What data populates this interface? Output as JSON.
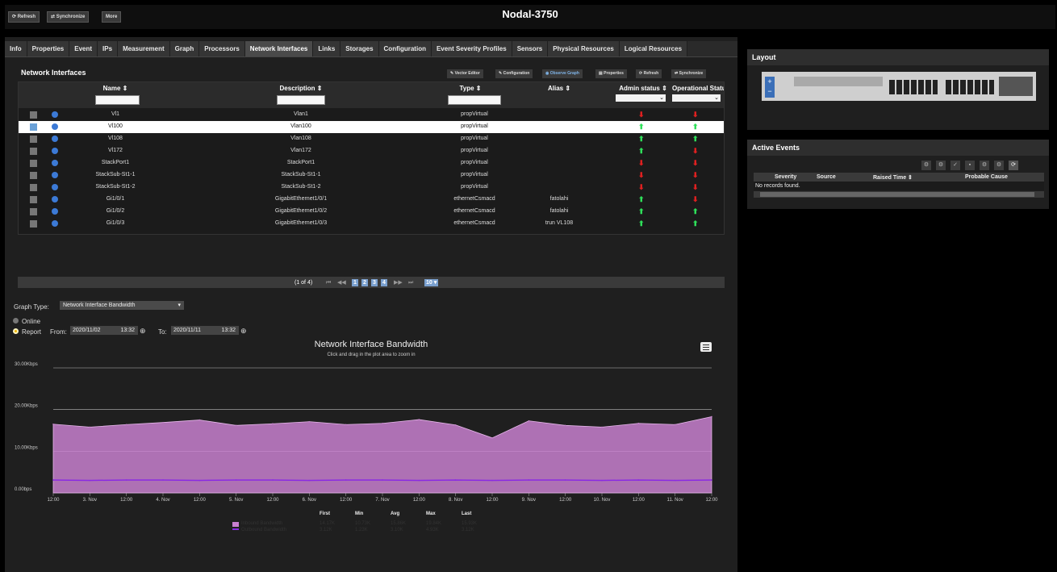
{
  "header": {
    "title": "Nodal-3750",
    "buttons": [
      {
        "label": "⟳ Refresh"
      },
      {
        "label": "⇄ Synchronize"
      },
      {
        "label": "More"
      }
    ]
  },
  "tabs": [
    "Info",
    "Properties",
    "Event",
    "IPs",
    "Measurement",
    "Graph",
    "Processors",
    "Network Interfaces",
    "Links",
    "Storages",
    "Configuration",
    "Event Severity Profiles",
    "Sensors",
    "Physical Resources",
    "Logical Resources"
  ],
  "active_tab": "Network Interfaces",
  "section": {
    "title": "Network Interfaces",
    "tools": [
      "✎ Vector Editor",
      "✎ Configuration",
      "◉ Observe Graph",
      "▤ Properties",
      "⟳ Refresh",
      "⇄ Synchronize"
    ]
  },
  "table": {
    "columns": {
      "name": "Name ⇕",
      "description": "Description ⇕",
      "type": "Type ⇕",
      "alias": "Alias ⇕",
      "admin": "Admin status ⇕",
      "oper": "Operational Status"
    },
    "rows": [
      {
        "name": "Vl1",
        "description": "Vlan1",
        "type": "propVirtual",
        "alias": "",
        "admin": "down",
        "oper": "down",
        "selected": false
      },
      {
        "name": "Vl100",
        "description": "Vlan100",
        "type": "propVirtual",
        "alias": "",
        "admin": "up",
        "oper": "up",
        "selected": true
      },
      {
        "name": "Vl108",
        "description": "Vlan108",
        "type": "propVirtual",
        "alias": "",
        "admin": "up",
        "oper": "up",
        "selected": false
      },
      {
        "name": "Vl172",
        "description": "Vlan172",
        "type": "propVirtual",
        "alias": "",
        "admin": "up",
        "oper": "down",
        "selected": false
      },
      {
        "name": "StackPort1",
        "description": "StackPort1",
        "type": "propVirtual",
        "alias": "",
        "admin": "down",
        "oper": "down",
        "selected": false
      },
      {
        "name": "StackSub-St1-1",
        "description": "StackSub-St1-1",
        "type": "propVirtual",
        "alias": "",
        "admin": "down",
        "oper": "down",
        "selected": false
      },
      {
        "name": "StackSub-St1-2",
        "description": "StackSub-St1-2",
        "type": "propVirtual",
        "alias": "",
        "admin": "down",
        "oper": "down",
        "selected": false
      },
      {
        "name": "Gi1/0/1",
        "description": "GigabitEthernet1/0/1",
        "type": "ethernetCsmacd",
        "alias": "fatolahi",
        "admin": "up",
        "oper": "down",
        "selected": false
      },
      {
        "name": "Gi1/0/2",
        "description": "GigabitEthernet1/0/2",
        "type": "ethernetCsmacd",
        "alias": "fatolahi",
        "admin": "up",
        "oper": "up",
        "selected": false
      },
      {
        "name": "Gi1/0/3",
        "description": "GigabitEthernet1/0/3",
        "type": "ethernetCsmacd",
        "alias": "trun VL108",
        "admin": "up",
        "oper": "up",
        "selected": false
      }
    ]
  },
  "pager": {
    "status": "(1 of 4)",
    "first": "⏮",
    "prev": "◀◀",
    "pages": [
      "1",
      "2",
      "3",
      "4"
    ],
    "next": "▶▶",
    "last": "⏭",
    "rows_per_page": "10 ▾"
  },
  "graph_controls": {
    "graph_type_label": "Graph Type:",
    "graph_type_value": "Network Interface Bandwidth",
    "online_label": "Online",
    "report_label": "Report",
    "from_label": "From:",
    "from_date": "2020/11/02",
    "from_time": "13:32",
    "to_label": "To:",
    "to_date": "2020/11/11",
    "to_time": "13:32"
  },
  "chart_data": {
    "type": "area",
    "title": "Network Interface Bandwidth",
    "subtitle": "Click and drag in the plot area to zoom in",
    "y_ticks": [
      "0.00bps",
      "10.00Kbps",
      "20.00Kbps",
      "30.00Kbps"
    ],
    "ylim": [
      0,
      30
    ],
    "y_unit": "Kbps",
    "x_ticks": [
      "12:00",
      "3. Nov",
      "12:00",
      "4. Nov",
      "12:00",
      "5. Nov",
      "12:00",
      "6. Nov",
      "12:00",
      "7. Nov",
      "12:00",
      "8. Nov",
      "12:00",
      "9. Nov",
      "12:00",
      "10. Nov",
      "12:00",
      "11. Nov",
      "12:00"
    ],
    "series": [
      {
        "name": "Inbound Bandwidth",
        "color": "#c880cf",
        "x": [
          "11/02 12:00",
          "11/03 00:00",
          "11/03 12:00",
          "11/04 00:00",
          "11/04 12:00",
          "11/05 00:00",
          "11/05 12:00",
          "11/06 00:00",
          "11/06 12:00",
          "11/07 00:00",
          "11/07 12:00",
          "11/08 00:00",
          "11/08 12:00",
          "11/09 00:00",
          "11/09 12:00",
          "11/10 00:00",
          "11/10 12:00",
          "11/11 00:00",
          "11/11 12:00"
        ],
        "values": [
          16.5,
          15.8,
          16.4,
          16.9,
          17.5,
          16.2,
          16.6,
          17.1,
          16.4,
          16.7,
          17.6,
          16.3,
          13.2,
          17.3,
          16.2,
          15.8,
          16.7,
          16.4,
          18.3
        ]
      },
      {
        "name": "Outbound Bandwidth",
        "color": "#8a2be2",
        "x": [
          "11/02 12:00",
          "11/03 00:00",
          "11/03 12:00",
          "11/04 00:00",
          "11/04 12:00",
          "11/05 00:00",
          "11/05 12:00",
          "11/06 00:00",
          "11/06 12:00",
          "11/07 00:00",
          "11/07 12:00",
          "11/08 00:00",
          "11/08 12:00",
          "11/09 00:00",
          "11/09 12:00",
          "11/10 00:00",
          "11/10 12:00",
          "11/11 00:00",
          "11/11 12:00"
        ],
        "values": [
          3.1,
          3.0,
          3.1,
          3.1,
          3.0,
          3.1,
          3.1,
          3.0,
          3.1,
          3.1,
          3.0,
          3.1,
          3.0,
          3.1,
          3.1,
          3.0,
          3.1,
          3.0,
          3.1
        ]
      }
    ],
    "legend_headers": [
      "First",
      "Min",
      "Avg",
      "Max",
      "Last"
    ],
    "legend_rows": [
      {
        "name": "Inbound Bandwidth",
        "vals": [
          "14.17K",
          "10.73K",
          "15.86K",
          "19.84K",
          "15.93K"
        ]
      },
      {
        "name": "Outbound Bandwidth",
        "vals": [
          "3.12K",
          "1.23K",
          "3.10K",
          "4.93K",
          "3.12K"
        ]
      }
    ]
  },
  "layout_panel": {
    "title": "Layout",
    "zoom_in": "+",
    "zoom_out": "−"
  },
  "events_panel": {
    "title": "Active Events",
    "columns": [
      "Severity",
      "Source",
      "Raised Time ⇕",
      "Probable Cause"
    ],
    "empty_text": "No records found."
  }
}
